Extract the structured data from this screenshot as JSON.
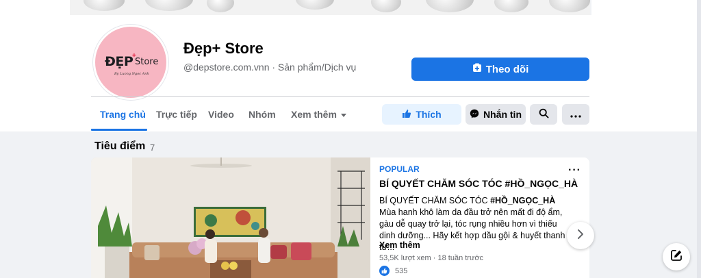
{
  "page": {
    "name": "Đẹp+ Store",
    "subtitle": "@depstore.com.vnn · Sản phẩm/Dịch vụ",
    "avatar_logo_main": "ĐẸP",
    "avatar_logo_plus": "+",
    "avatar_logo_store": "Store",
    "avatar_logo_sub": "By Luong Ngoc Anh"
  },
  "actions": {
    "follow_label": "Theo dõi",
    "like_label": "Thích",
    "message_label": "Nhắn tin"
  },
  "tabs": [
    {
      "label": "Trang chủ",
      "active": true
    },
    {
      "label": "Trực tiếp",
      "active": false
    },
    {
      "label": "Video",
      "active": false
    },
    {
      "label": "Nhóm",
      "active": false
    },
    {
      "label": "Xem thêm",
      "active": false
    }
  ],
  "featured": {
    "title": "Tiêu điểm",
    "count": "7"
  },
  "post": {
    "tag": "POPULAR",
    "title": "BÍ QUYẾT CHĂM SÓC TÓC #HỒ_NGỌC_HÀ",
    "body_prefix": "BÍ QUYẾT CHĂM SÓC TÓC ",
    "body_hashtag": "#HỒ_NGỌC_HÀ",
    "body_rest": " Mùa hanh khô làm da đầu trở nên mất đi độ ẩm, gàu dễ quay trở lại, tóc rụng nhiều hơn vì thiếu dinh dưỡng... Hãy kết hợp dầu gội & huyết thanh từ...",
    "see_more": "Xem thêm",
    "meta": "53,5K lượt xem · 18 tuần trước",
    "reaction_count": "535"
  },
  "colors": {
    "accent": "#1b74e4",
    "avatar_bg": "#f7b6c2",
    "page_bg": "#f0f2f5"
  },
  "icons": {
    "follow": "follow-plus-icon",
    "like": "thumbs-up-icon",
    "message": "messenger-icon",
    "search": "search-icon",
    "more": "more-dots-icon",
    "next": "chevron-right-icon",
    "compose": "compose-icon"
  }
}
